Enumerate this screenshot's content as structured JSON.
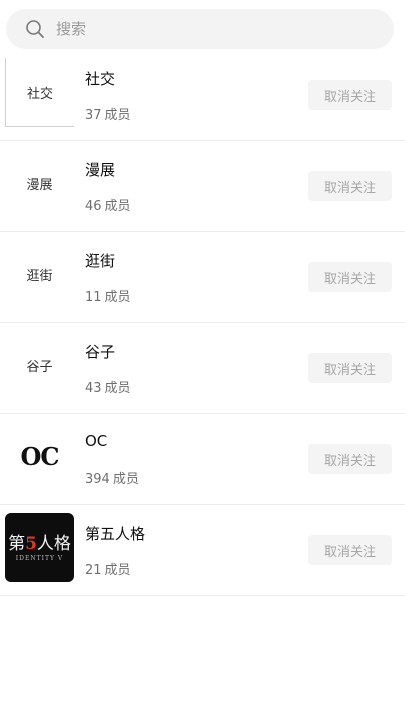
{
  "search": {
    "placeholder": "搜索"
  },
  "unfollow_label": "取消关注",
  "members_suffix": "成员",
  "groups": [
    {
      "name": "社交",
      "members": "37",
      "thumb_text": "社交"
    },
    {
      "name": "漫展",
      "members": "46",
      "thumb_text": "漫展"
    },
    {
      "name": "逛街",
      "members": "11",
      "thumb_text": "逛街"
    },
    {
      "name": "谷子",
      "members": "43",
      "thumb_text": "谷子"
    },
    {
      "name": "OC",
      "members": "394",
      "thumb_text": "OC"
    },
    {
      "name": "第五人格",
      "members": "21",
      "thumb_title_a": "第",
      "thumb_title_b": "5",
      "thumb_title_c": "人格",
      "thumb_subtitle": "IDENTITY V"
    }
  ],
  "colors": {
    "search_bg": "#f3f3f4",
    "button_bg": "#f4f4f4",
    "button_text": "#a6a6a6",
    "accent_red": "#d63a2c"
  }
}
